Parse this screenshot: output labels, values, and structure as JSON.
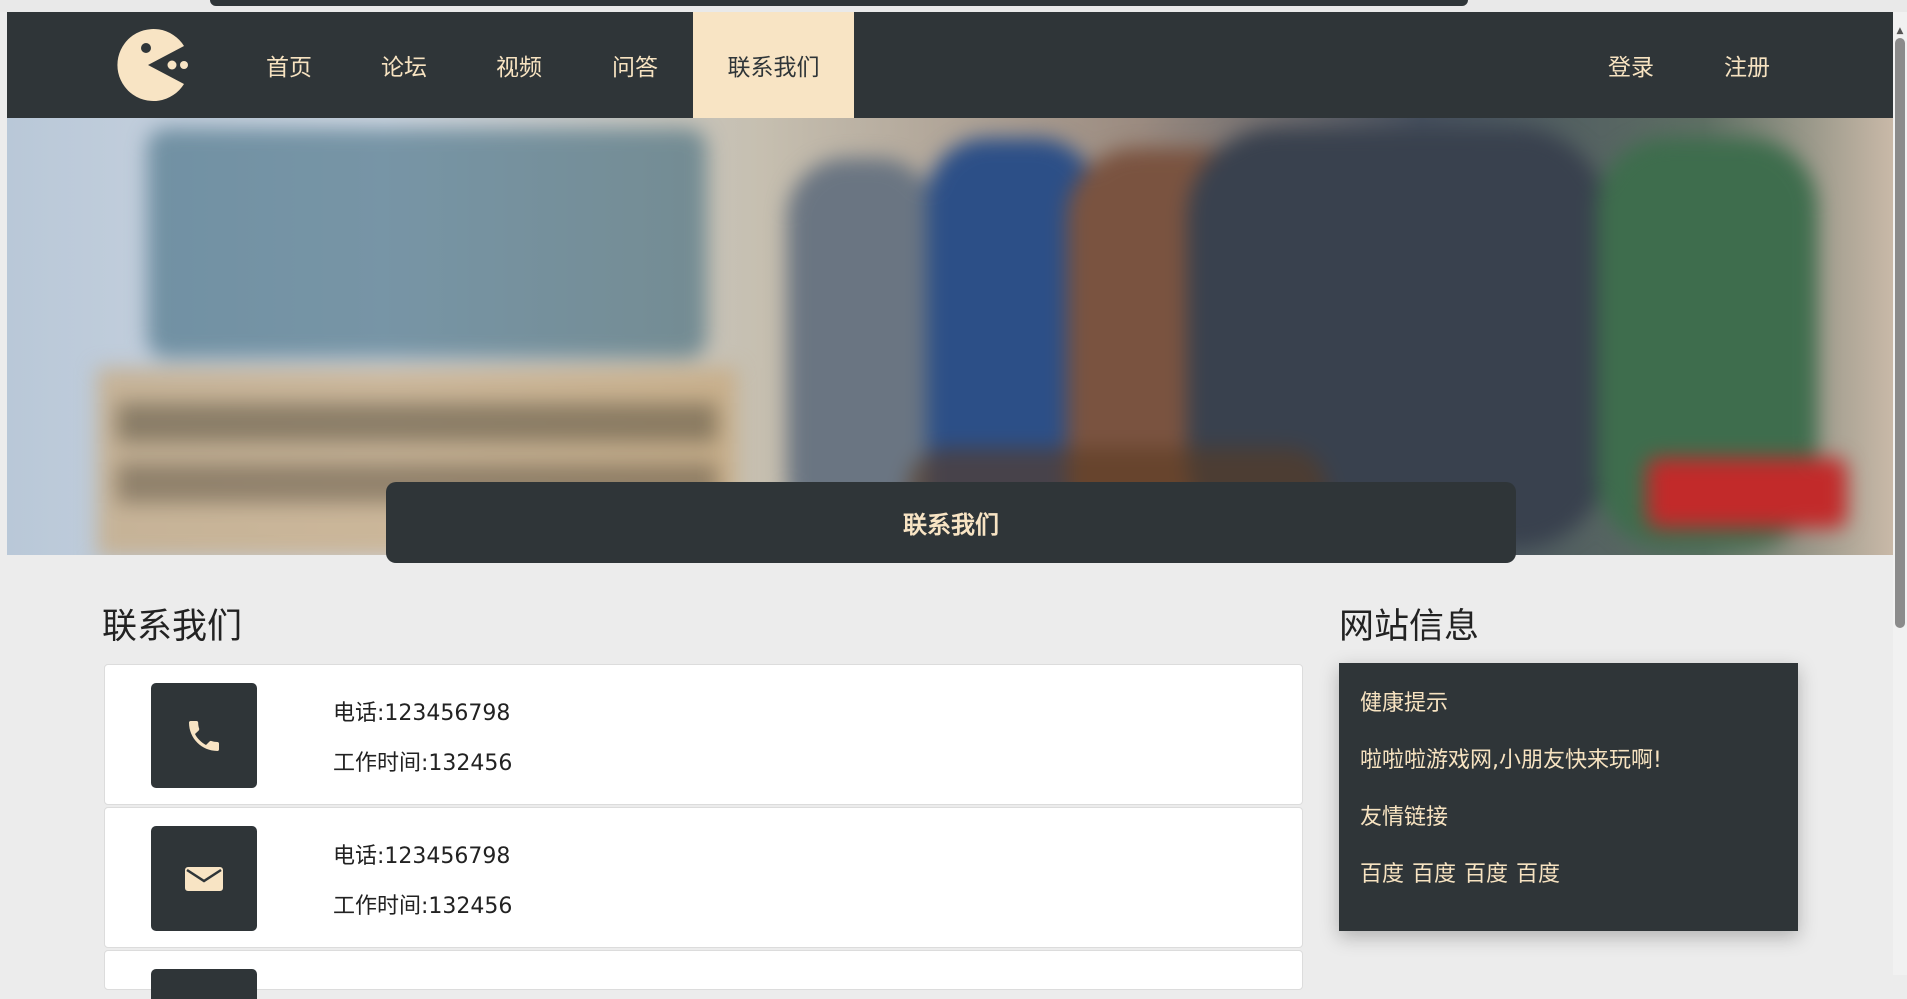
{
  "nav": {
    "items": [
      {
        "label": "首页"
      },
      {
        "label": "论坛"
      },
      {
        "label": "视频"
      },
      {
        "label": "问答"
      },
      {
        "label": "联系我们"
      }
    ],
    "login_label": "登录",
    "register_label": "注册",
    "active_item": "联系我们"
  },
  "banner": {
    "title_box_label": "联系我们"
  },
  "contact": {
    "heading": "联系我们",
    "cards": [
      {
        "icon": "phone-icon",
        "line1": "电话:123456798",
        "line2": "工作时间:132456"
      },
      {
        "icon": "envelope-icon",
        "line1": "电话:123456798",
        "line2": "工作时间:132456"
      }
    ]
  },
  "site_info": {
    "heading": "网站信息",
    "health_tip_label": "健康提示",
    "health_tip_text": "啦啦啦游戏网,小朋友快来玩啊!",
    "friend_links_label": "友情链接",
    "friend_links": [
      "百度",
      "百度",
      "百度",
      "百度"
    ]
  },
  "colors": {
    "dark": "#2f3538",
    "accent": "#f8e4c4",
    "background": "#ececec"
  }
}
